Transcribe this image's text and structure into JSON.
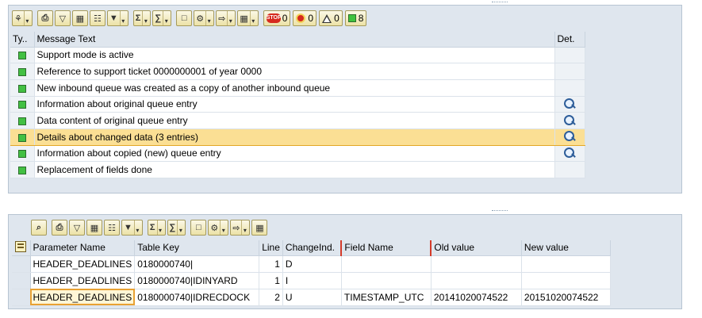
{
  "toolbar": {
    "icons": [
      "log-settings-icon",
      "print-icon",
      "filter-icon",
      "find-icon",
      "find-next-icon",
      "set-filter-icon",
      "sum-icon",
      "subtotal-icon",
      "print-preview-icon",
      "change-layout-icon",
      "export-icon",
      "select-layout-icon"
    ],
    "counts": {
      "stop": "0",
      "error": "0",
      "warning": "0",
      "success": "8"
    },
    "stop_label": "STOP"
  },
  "messages": {
    "headers": {
      "type": "Ty..",
      "text": "Message Text",
      "detail": "Det."
    },
    "rows": [
      {
        "status": "success",
        "text": "Support mode is active",
        "has_detail": false
      },
      {
        "status": "success",
        "text": "Reference to support ticket 0000000001 of year 0000",
        "has_detail": false
      },
      {
        "status": "success",
        "text": "New inbound queue was created as a copy of another inbound queue",
        "has_detail": false
      },
      {
        "status": "success",
        "text": "Information about original queue entry",
        "has_detail": true
      },
      {
        "status": "success",
        "text": "Data content of original queue entry",
        "has_detail": true
      },
      {
        "status": "success",
        "text": "Details about changed data (3 entries)",
        "has_detail": true,
        "selected": true
      },
      {
        "status": "success",
        "text": "Information about copied (new) queue entry",
        "has_detail": true
      },
      {
        "status": "success",
        "text": "Replacement of fields done",
        "has_detail": false
      }
    ]
  },
  "details": {
    "headers": [
      "Parameter Name",
      "Table Key",
      "Line",
      "ChangeInd.",
      "Field Name",
      "Old value",
      "New value"
    ],
    "rows": [
      [
        "HEADER_DEADLINES",
        "0180000740|",
        "1",
        "D",
        "",
        "",
        ""
      ],
      [
        "HEADER_DEADLINES",
        "0180000740|IDINYARD",
        "1",
        "I",
        "",
        "",
        ""
      ],
      [
        "HEADER_DEADLINES",
        "0180000740|IDRECDOCK",
        "2",
        "U",
        "TIMESTAMP_UTC",
        "20141020074522",
        "20151020074522"
      ]
    ]
  },
  "colors": {
    "panel": "#dfe6ee",
    "selected_row": "#fbdf94",
    "success": "#43c043",
    "stop": "#d62a1e"
  }
}
